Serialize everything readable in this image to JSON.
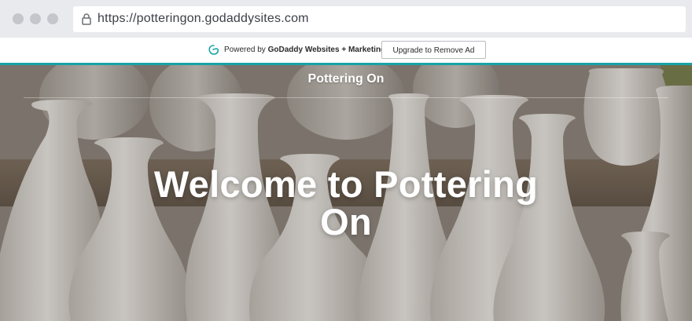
{
  "browser": {
    "url": "https://potteringon.godaddysites.com"
  },
  "ad_bar": {
    "powered_prefix": "Powered by",
    "powered_brand": "GoDaddy Websites + Marketing.",
    "upgrade_button": "Upgrade to Remove Ad",
    "accent_color": "#17a3a6"
  },
  "header": {
    "site_title": "Pottering On"
  },
  "hero": {
    "headline": "Welcome to Pottering On"
  }
}
